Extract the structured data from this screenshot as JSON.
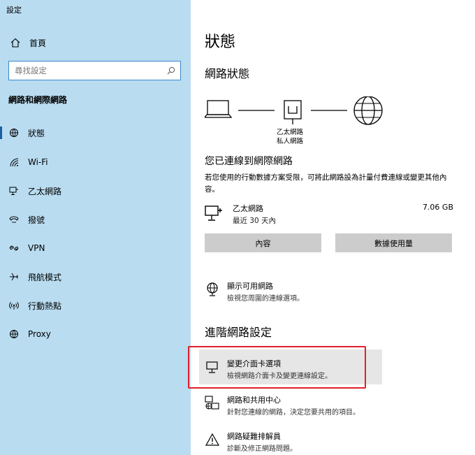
{
  "app": {
    "title": "設定"
  },
  "sidebar": {
    "home_label": "首頁",
    "search_placeholder": "尋找設定",
    "section_title": "網路和網際網路",
    "items": [
      {
        "label": "狀態",
        "icon": "status-icon",
        "active": true
      },
      {
        "label": "Wi-Fi",
        "icon": "wifi-icon"
      },
      {
        "label": "乙太網路",
        "icon": "ethernet-icon"
      },
      {
        "label": "撥號",
        "icon": "dialup-icon"
      },
      {
        "label": "VPN",
        "icon": "vpn-icon"
      },
      {
        "label": "飛航模式",
        "icon": "airplane-icon"
      },
      {
        "label": "行動熱點",
        "icon": "hotspot-icon"
      },
      {
        "label": "Proxy",
        "icon": "globe-icon"
      }
    ]
  },
  "main": {
    "page_title": "狀態",
    "network_status_heading": "網路狀態",
    "diagram": {
      "adapter_name": "乙太網路",
      "network_type": "私人網路"
    },
    "connected_heading": "您已連線到網際網路",
    "connected_desc": "若您使用的行動數據方案受限，可將此網路設為計量付費連線或變更其他內容。",
    "connection": {
      "name": "乙太網路",
      "period": "最近 30 天內",
      "usage": "7.06 GB"
    },
    "buttons": {
      "properties": "內容",
      "data_usage": "數據使用量"
    },
    "show_networks": {
      "title": "顯示可用網路",
      "desc": "檢視您周圍的連線選項。"
    },
    "advanced_heading": "進階網路設定",
    "adapter_options": {
      "title": "變更介面卡選項",
      "desc": "檢視網路介面卡及變更連線設定。"
    },
    "sharing_center": {
      "title": "網路和共用中心",
      "desc": "針對您連線的網路，決定您要共用的項目。"
    },
    "troubleshooter": {
      "title": "網路疑難排解員",
      "desc": "診斷及修正網路問題。"
    }
  },
  "colors": {
    "sidebar_bg": "#b9dcf0",
    "highlight_border": "#e0202a",
    "button_bg": "#cccccc",
    "hover_bg": "#e6e6e6"
  }
}
